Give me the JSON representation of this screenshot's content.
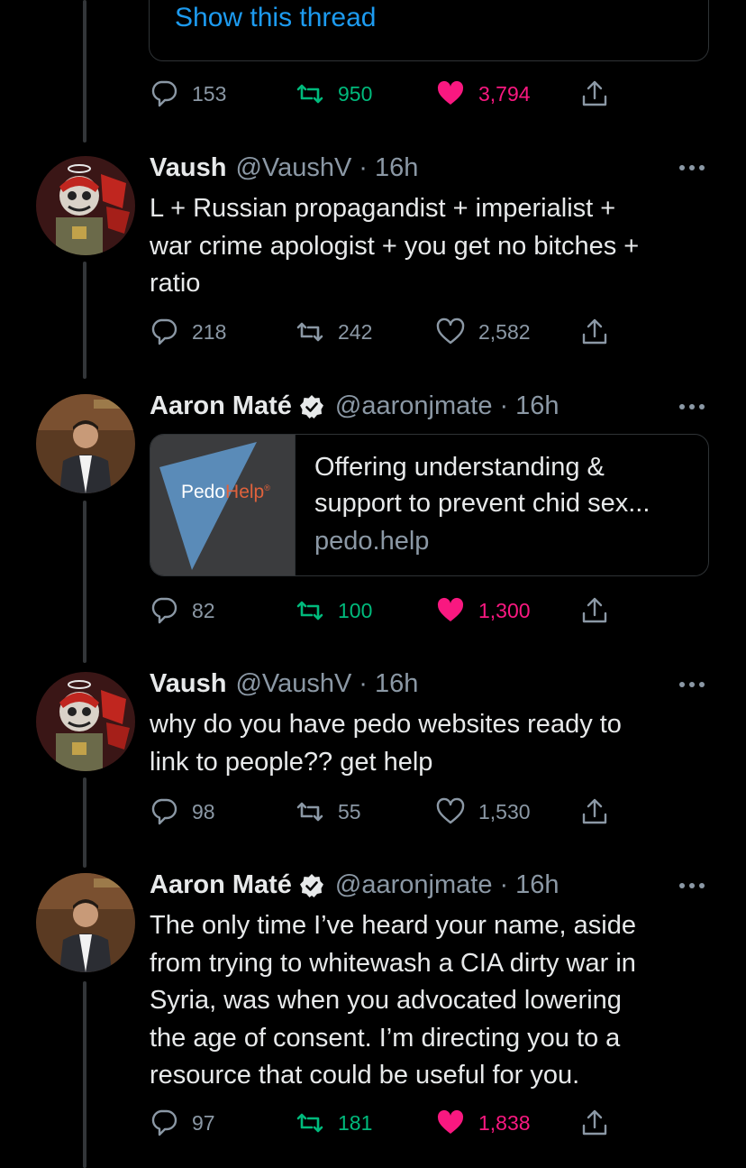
{
  "show_thread": {
    "label": "Show this thread"
  },
  "colors": {
    "accent": "#1d9bf0",
    "retweet_active": "#00ba7c",
    "like_active": "#f91880",
    "muted": "#8b98a5",
    "text": "#e7e9ea"
  },
  "tweets": [
    {
      "author": "",
      "actions": {
        "replies": "153",
        "retweets": "950",
        "likes": "3,794",
        "retweeted": true,
        "liked": true
      }
    },
    {
      "name": "Vaush",
      "handle": "@VaushV",
      "time": "· 16h",
      "avatar_icon": "cartoon-avatar-icon",
      "text_lines": [
        "L + Russian propagandist + imperialist +",
        "war crime apologist + you get no bitches +",
        "ratio"
      ],
      "actions": {
        "replies": "218",
        "retweets": "242",
        "likes": "2,582",
        "retweeted": false,
        "liked": false
      }
    },
    {
      "name": "Aaron Maté",
      "handle": "@aaronjmate",
      "time": "· 16h",
      "verified": true,
      "avatar_icon": "photo-avatar-icon",
      "link_card": {
        "thumb_logo_part1": "Pedo",
        "thumb_logo_part2": "Help",
        "thumb_logo_mark": "®",
        "title_lines": [
          "Offering understanding &",
          "support to prevent chid sex..."
        ],
        "domain": "pedo.help"
      },
      "actions": {
        "replies": "82",
        "retweets": "100",
        "likes": "1,300",
        "retweeted": true,
        "liked": true
      }
    },
    {
      "name": "Vaush",
      "handle": "@VaushV",
      "time": "· 16h",
      "avatar_icon": "cartoon-avatar-icon",
      "text_lines": [
        "why do you have pedo websites ready to",
        "link to people?? get help"
      ],
      "actions": {
        "replies": "98",
        "retweets": "55",
        "likes": "1,530",
        "retweeted": false,
        "liked": false
      }
    },
    {
      "name": "Aaron Maté",
      "handle": "@aaronjmate",
      "time": "· 16h",
      "verified": true,
      "avatar_icon": "photo-avatar-icon",
      "text_lines": [
        "The only time I’ve heard your name, aside",
        "from trying to whitewash a CIA dirty war in",
        "Syria, was when you advocated lowering",
        "the age of consent. I’m directing you to a",
        "resource that could be useful for you."
      ],
      "actions": {
        "replies": "97",
        "retweets": "181",
        "likes": "1,838",
        "retweeted": true,
        "liked": true
      }
    }
  ]
}
